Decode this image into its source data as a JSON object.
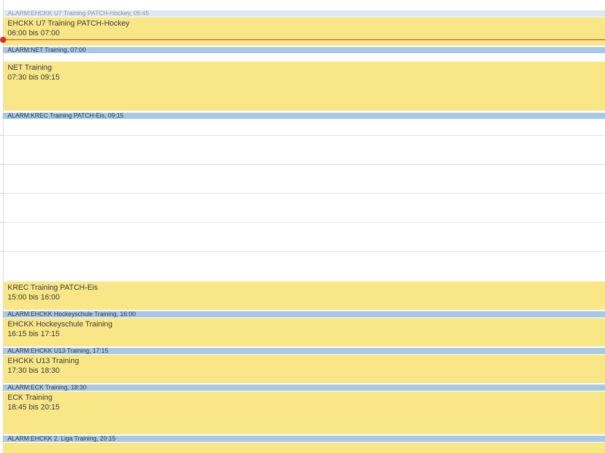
{
  "calendar": {
    "view": "day",
    "colors": {
      "event": "#f9e787",
      "alarm": "#a8c8e6",
      "now_indicator": "#d6322a"
    },
    "alarms": [
      {
        "label": "ALARM:EHCKK U7 Training PATCH-Hockey, 05:45"
      },
      {
        "label": "ALARM:NET Training, 07:00"
      },
      {
        "label": "ALARM:KREC Training PATCH-Eis, 09:15"
      },
      {
        "label": "ALARM:EHCKK Hockeyschule Training, 16:00"
      },
      {
        "label": "ALARM:EHCKK U13 Training, 17:15"
      },
      {
        "label": "ALARM:ECK Training, 18:30"
      },
      {
        "label": "ALARM:EHCKK 2. Liga Training, 20:15"
      }
    ],
    "events": [
      {
        "title": "EHCKK U7 Training PATCH-Hockey",
        "time": "06:00 bis 07:00"
      },
      {
        "title": "NET Training",
        "time": "07:30 bis 09:15"
      },
      {
        "title": "KREC Training PATCH-Eis",
        "time": "15:00 bis 16:00"
      },
      {
        "title": "EHCKK Hockeyschule Training",
        "time": "16:15 bis 17:15"
      },
      {
        "title": "EHCKK U13 Training",
        "time": "17:30 bis 18:30"
      },
      {
        "title": "ECK Training",
        "time": "18:45 bis 20:15"
      }
    ]
  }
}
